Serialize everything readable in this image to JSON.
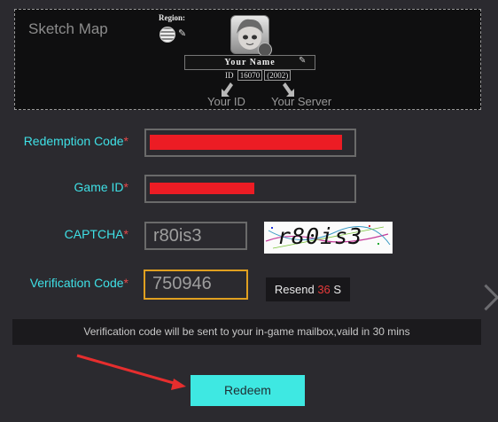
{
  "sketch": {
    "title": "Sketch Map",
    "region_label": "Region:",
    "player_name": "Your Name",
    "id_prefix": "ID",
    "id_number": "16070",
    "server_number": "(2002)",
    "caption_id": "Your ID",
    "caption_server": "Your Server"
  },
  "form": {
    "redemption_label": "Redemption Code",
    "game_id_label": "Game ID",
    "captcha_label": "CAPTCHA",
    "verification_label": "Verification Code",
    "required_mark": "*",
    "captcha_value": "r80is3",
    "captcha_image_text": "r80is3",
    "verification_value": "750946",
    "resend_label": "Resend",
    "resend_count": "36",
    "resend_unit": "S",
    "notice": "Verification code will be sent to your in-game mailbox,vaild in 30 mins",
    "redeem_label": "Redeem"
  },
  "colors": {
    "accent_cyan": "#3fe0e6",
    "required_red": "#e54a4a",
    "focus_border": "#e0a020",
    "redaction": "#ec1c24",
    "annotation_arrow": "#e62e2e"
  },
  "icons": [
    "globe-icon",
    "pencil-icon",
    "avatar-image",
    "chevron-right-icon",
    "down-arrow-icon"
  ]
}
